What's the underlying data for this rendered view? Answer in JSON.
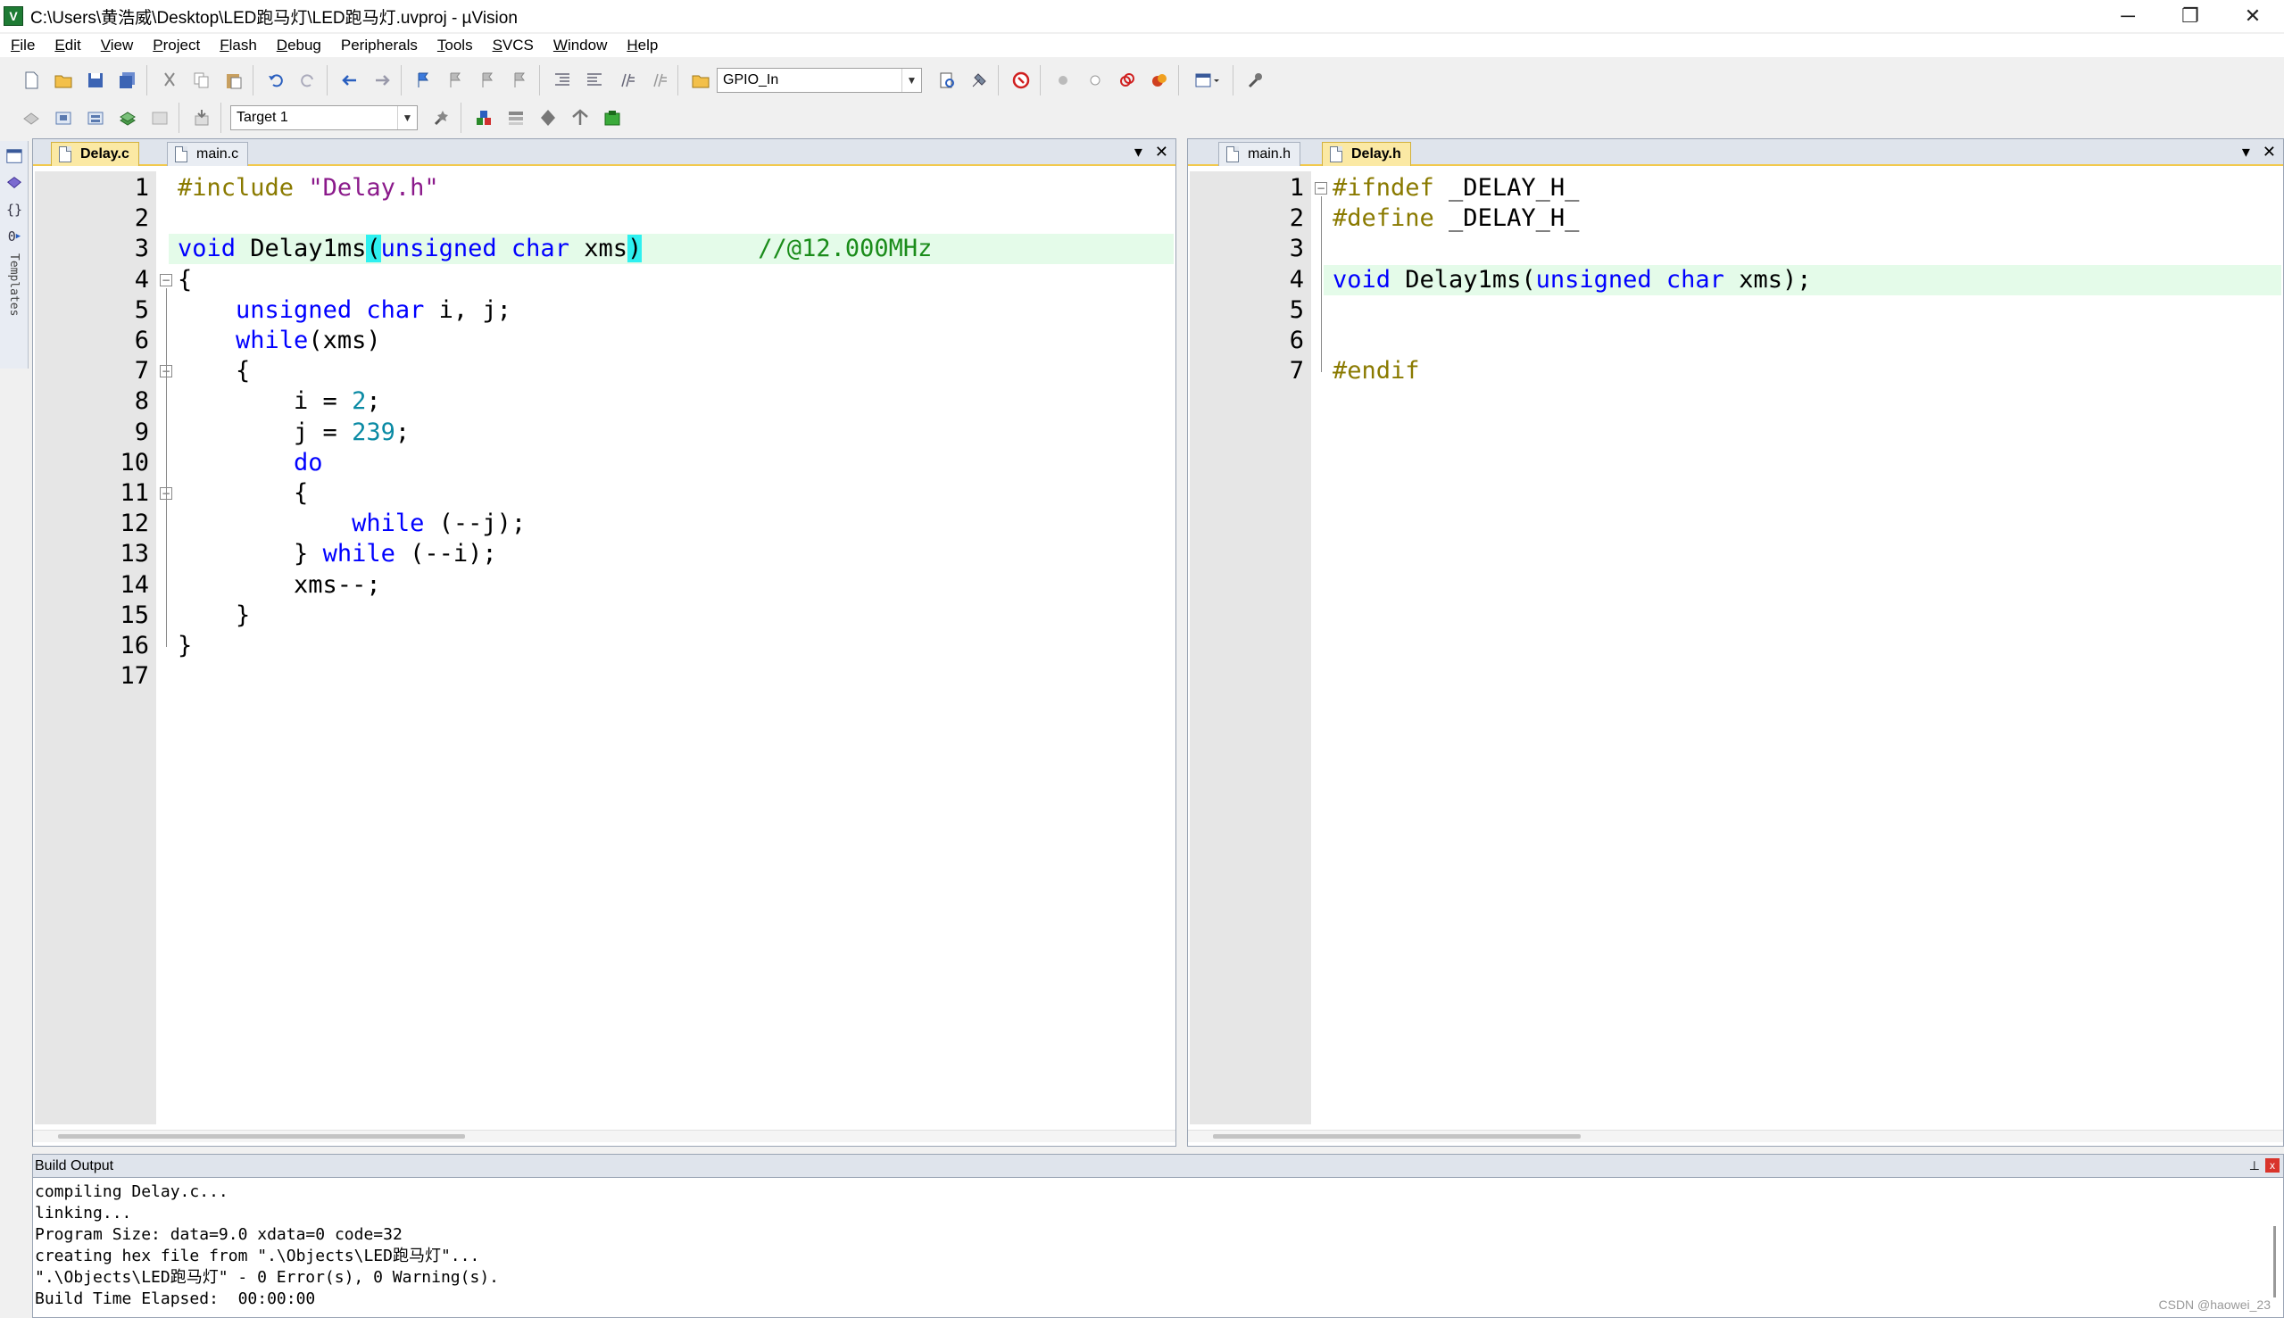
{
  "window": {
    "title": "C:\\Users\\黄浩威\\Desktop\\LED跑马灯\\LED跑马灯.uvproj - µVision",
    "icon_letter": "V",
    "minimize": "─",
    "restore": "❐",
    "close": "✕"
  },
  "menu": [
    {
      "key": "F",
      "rest": "ile"
    },
    {
      "key": "E",
      "rest": "dit"
    },
    {
      "key": "V",
      "rest": "iew"
    },
    {
      "key": "P",
      "rest": "roject"
    },
    {
      "key": "F",
      "rest": "lash",
      "pre": ""
    },
    {
      "key": "D",
      "rest": "ebug"
    },
    {
      "key": "",
      "rest": "Peripherals",
      "ulpos": 1
    },
    {
      "key": "T",
      "rest": "ools"
    },
    {
      "key": "S",
      "rest": "VCS"
    },
    {
      "key": "W",
      "rest": "indow"
    },
    {
      "key": "H",
      "rest": "elp"
    }
  ],
  "toolbar": {
    "find_combo_value": "GPIO_In",
    "target_combo_value": "Target 1"
  },
  "sidebar": {
    "vertical_label": "Templates"
  },
  "left_pane": {
    "tabs": [
      {
        "label": "Delay.c",
        "active": true
      },
      {
        "label": "main.c",
        "active": false
      }
    ],
    "dropdown": "▾",
    "close": "✕"
  },
  "right_pane": {
    "tabs": [
      {
        "label": "main.h",
        "active": false
      },
      {
        "label": "Delay.h",
        "active": true
      }
    ],
    "dropdown": "▾",
    "close": "✕"
  },
  "code_left": [
    {
      "n": "1",
      "segs": [
        [
          "pp",
          "#include "
        ],
        [
          "str",
          "\"Delay.h\""
        ]
      ]
    },
    {
      "n": "2",
      "segs": []
    },
    {
      "n": "3",
      "hl": true,
      "segs": [
        [
          "kw",
          "void"
        ],
        [
          "",
          " Delay1ms"
        ],
        [
          "bm",
          "("
        ],
        [
          "kw",
          "unsigned"
        ],
        [
          "",
          " "
        ],
        [
          "kw",
          "char"
        ],
        [
          "",
          " xms"
        ],
        [
          "bm",
          ")"
        ],
        [
          "",
          "        "
        ],
        [
          "cm",
          "//@12.000MHz"
        ]
      ]
    },
    {
      "n": "4",
      "fold": "open",
      "segs": [
        [
          "",
          "{"
        ]
      ]
    },
    {
      "n": "5",
      "segs": [
        [
          "",
          "    "
        ],
        [
          "kw",
          "unsigned"
        ],
        [
          "",
          " "
        ],
        [
          "kw",
          "char"
        ],
        [
          "",
          " i, j;"
        ]
      ]
    },
    {
      "n": "6",
      "segs": [
        [
          "",
          "    "
        ],
        [
          "kw",
          "while"
        ],
        [
          "",
          "(xms)"
        ]
      ]
    },
    {
      "n": "7",
      "fold": "open",
      "segs": [
        [
          "",
          "    {"
        ]
      ]
    },
    {
      "n": "8",
      "segs": [
        [
          "",
          "        i = "
        ],
        [
          "num",
          "2"
        ],
        [
          "",
          ";"
        ]
      ]
    },
    {
      "n": "9",
      "segs": [
        [
          "",
          "        j = "
        ],
        [
          "num",
          "239"
        ],
        [
          "",
          ";"
        ]
      ]
    },
    {
      "n": "10",
      "segs": [
        [
          "",
          "        "
        ],
        [
          "kw",
          "do"
        ]
      ]
    },
    {
      "n": "11",
      "fold": "open",
      "segs": [
        [
          "",
          "        {"
        ]
      ]
    },
    {
      "n": "12",
      "segs": [
        [
          "",
          "            "
        ],
        [
          "kw",
          "while"
        ],
        [
          "",
          " (--j);"
        ]
      ]
    },
    {
      "n": "13",
      "segs": [
        [
          "",
          "        } "
        ],
        [
          "kw",
          "while"
        ],
        [
          "",
          " (--i);"
        ]
      ]
    },
    {
      "n": "14",
      "segs": [
        [
          "",
          "        xms--;"
        ]
      ]
    },
    {
      "n": "15",
      "segs": [
        [
          "",
          "    }"
        ]
      ]
    },
    {
      "n": "16",
      "segs": [
        [
          "",
          "}"
        ]
      ]
    },
    {
      "n": "17",
      "segs": []
    }
  ],
  "code_right": [
    {
      "n": "1",
      "fold": "open",
      "segs": [
        [
          "pp",
          "#ifndef"
        ],
        [
          "",
          " _DELAY_H_"
        ]
      ]
    },
    {
      "n": "2",
      "segs": [
        [
          "pp",
          "#define"
        ],
        [
          "",
          " _DELAY_H_"
        ]
      ]
    },
    {
      "n": "3",
      "segs": []
    },
    {
      "n": "4",
      "hl": true,
      "segs": [
        [
          "kw",
          "void"
        ],
        [
          "",
          " Delay1ms("
        ],
        [
          "kw",
          "unsigned"
        ],
        [
          "",
          " "
        ],
        [
          "kw",
          "char"
        ],
        [
          "",
          " xms);"
        ]
      ]
    },
    {
      "n": "5",
      "segs": []
    },
    {
      "n": "6",
      "segs": []
    },
    {
      "n": "7",
      "segs": [
        [
          "pp",
          "#endif"
        ]
      ]
    }
  ],
  "build_output": {
    "title": "Build Output",
    "pin": "⊥",
    "close": "x",
    "lines": [
      "compiling Delay.c...",
      "linking...",
      "Program Size: data=9.0 xdata=0 code=32",
      "creating hex file from \".\\Objects\\LED跑马灯\"...",
      "\".\\Objects\\LED跑马灯\" - 0 Error(s), 0 Warning(s).",
      "Build Time Elapsed:  00:00:00"
    ],
    "watermark": "CSDN @haowei_23"
  }
}
